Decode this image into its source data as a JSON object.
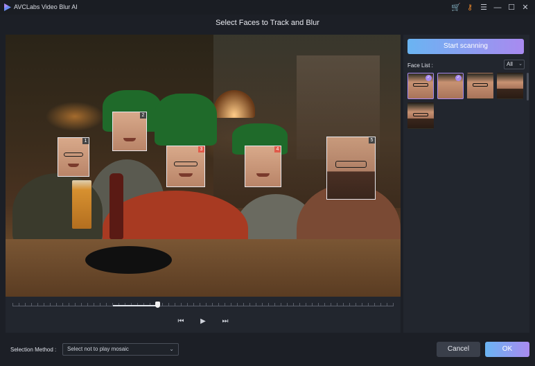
{
  "window": {
    "title": "AVCLabs Video Blur AI",
    "icons": [
      "cart-icon",
      "key-icon",
      "menu-icon",
      "minimize-icon",
      "maximize-icon",
      "close-icon"
    ]
  },
  "page": {
    "title": "Select Faces to Track and Blur"
  },
  "video": {
    "faces": [
      {
        "number": "1",
        "selected": false
      },
      {
        "number": "2",
        "selected": false
      },
      {
        "number": "3",
        "selected": true
      },
      {
        "number": "4",
        "selected": true
      },
      {
        "number": "5",
        "selected": false
      }
    ],
    "timeline": {
      "position_fraction": 0.38
    }
  },
  "controls": {
    "prev_icon": "⏮",
    "play_icon": "▶",
    "next_icon": "⏭"
  },
  "sidebar": {
    "scan_label": "Start scanning",
    "face_list_label": "Face List :",
    "filter_value": "All",
    "thumbnails": [
      {
        "selected": true
      },
      {
        "selected": true
      },
      {
        "selected": false
      },
      {
        "selected": false
      },
      {
        "selected": false
      }
    ]
  },
  "footer": {
    "selection_label": "Selection Method :",
    "selection_value": "Select not to play mosaic",
    "cancel_label": "Cancel",
    "ok_label": "OK"
  },
  "colors": {
    "accent_start": "#6ab4f2",
    "accent_end": "#a98af0",
    "face_number_active": "#e05a4a"
  }
}
